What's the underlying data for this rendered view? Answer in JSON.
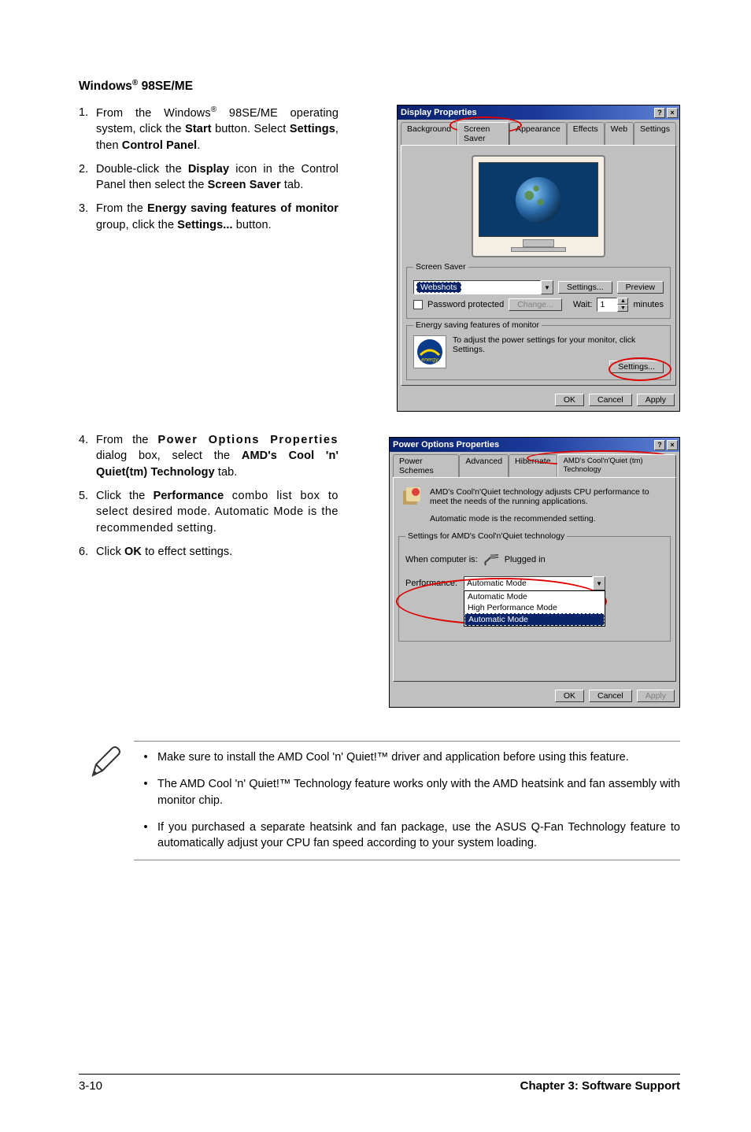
{
  "heading_prefix": "Windows",
  "heading_suffix": " 98SE/ME",
  "reg": "®",
  "section1": {
    "steps": [
      {
        "num": "1.",
        "html_prefix": "From the Windows",
        "reg": "®",
        "html_mid": " 98SE/ME operating system, click the ",
        "b1": "Start",
        "mid2": " button. Select ",
        "b2": "Settings",
        "mid3": ", then ",
        "b3": "Control Panel",
        "end": "."
      },
      {
        "num": "2.",
        "t": "Double-click the ",
        "b1": "Display",
        "t2": " icon in the Control Panel then select the ",
        "b2": "Screen Saver",
        "t3": " tab."
      },
      {
        "num": "3.",
        "t": "From the ",
        "b1": "Energy saving features of monitor",
        "t2": " group, click the ",
        "b2": "Settings...",
        "t3": " button."
      }
    ]
  },
  "section2": {
    "steps": [
      {
        "num": "4.",
        "t": "From the ",
        "b1": "Power Options Properties",
        "t2": " dialog box, select the ",
        "b2": "AMD's Cool 'n' Quiet(tm) Technology",
        "t3": " tab."
      },
      {
        "num": "5.",
        "t": "Click the ",
        "b1": "Performance",
        "t2": " combo list box to select desired mode.  Automatic Mode is the recommended setting.",
        "b2": "",
        "t3": ""
      },
      {
        "num": "6.",
        "t": "Click ",
        "b1": "OK",
        "t2": " to effect settings.",
        "b2": "",
        "t3": ""
      }
    ]
  },
  "dlg1": {
    "title": "Display Properties",
    "tabs": [
      "Background",
      "Screen Saver",
      "Appearance",
      "Effects",
      "Web",
      "Settings"
    ],
    "active_tab_index": 1,
    "ss_group": "Screen Saver",
    "ss_selected": "Webshots",
    "btn_settings": "Settings...",
    "btn_preview": "Preview",
    "chk_pass": "Password protected",
    "btn_change": "Change...",
    "wait_label": "Wait:",
    "wait_value": "1",
    "wait_unit": "minutes",
    "energy_group": "Energy saving features of monitor",
    "energy_text": "To adjust the power settings for your monitor, click Settings.",
    "btn_energy_settings": "Settings...",
    "ok": "OK",
    "cancel": "Cancel",
    "apply": "Apply"
  },
  "dlg2": {
    "title": "Power Options Properties",
    "tabs": [
      "Power Schemes",
      "Advanced",
      "Hibernate",
      "AMD's Cool'n'Quiet (tm) Technology"
    ],
    "active_tab_index": 3,
    "info_text": "AMD's Cool'n'Quiet technology adjusts CPU performance to meet the needs of the running applications.",
    "auto_text": "Automatic mode is the recommended setting.",
    "settings_group": "Settings for AMD's Cool'n'Quiet technology",
    "when_label": "When computer is:",
    "when_value": "Plugged in",
    "perf_label": "Performance:",
    "perf_selected": "Automatic Mode",
    "perf_options": [
      "Automatic Mode",
      "High Performance Mode",
      "Automatic Mode"
    ],
    "ok": "OK",
    "cancel": "Cancel",
    "apply": "Apply"
  },
  "notes": [
    "Make sure to install the AMD Cool 'n' Quiet!™ driver and application before using this feature.",
    "The AMD Cool 'n' Quiet!™ Technology feature works only with the AMD heatsink and fan assembly with monitor chip.",
    "If you purchased a separate heatsink and fan package, use the ASUS Q-Fan Technology feature to automatically adjust your CPU fan speed according to your system loading."
  ],
  "footer": {
    "left": "3-10",
    "right": "Chapter 3: Software Support"
  }
}
